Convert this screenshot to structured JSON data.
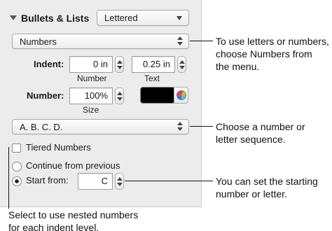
{
  "section": {
    "title": "Bullets & Lists",
    "style_value": "Lettered"
  },
  "type_popup": {
    "value": "Numbers"
  },
  "indent": {
    "label": "Indent:",
    "number_value": "0 in",
    "number_caption": "Number",
    "text_value": "0.25 in",
    "text_caption": "Text"
  },
  "number_size": {
    "label": "Number:",
    "value": "100%",
    "caption": "Size",
    "color": "#000000"
  },
  "sequence_popup": {
    "value": "A. B. C. D."
  },
  "tiered": {
    "label": "Tiered Numbers",
    "checked": false
  },
  "continue_option": {
    "label": "Continue from previous",
    "selected": false
  },
  "start_option": {
    "label": "Start from:",
    "selected": true,
    "value": "C"
  },
  "callouts": {
    "type": [
      "To use letters or numbers,",
      "choose Numbers from",
      "the menu."
    ],
    "sequence": [
      "Choose a number or",
      "letter sequence."
    ],
    "start": [
      "You can set the starting",
      "number or letter."
    ],
    "tiered": [
      "Select to use nested numbers",
      "for each indent level."
    ]
  }
}
